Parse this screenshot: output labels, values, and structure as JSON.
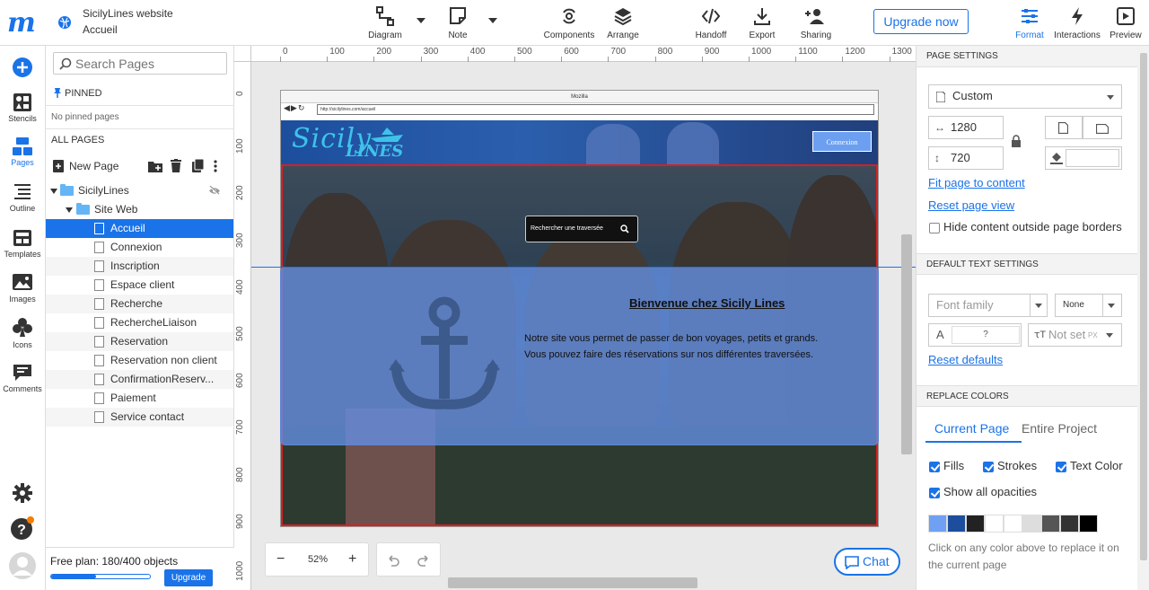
{
  "header": {
    "project_title": "SicilyLines website",
    "page_name": "Accueil",
    "tools": [
      {
        "label": "Diagram",
        "icon": "diagram-icon"
      },
      {
        "label": "Note",
        "icon": "note-icon"
      },
      {
        "label": "Components",
        "icon": "components-icon"
      },
      {
        "label": "Arrange",
        "icon": "arrange-icon"
      },
      {
        "label": "Handoff",
        "icon": "handoff-icon"
      },
      {
        "label": "Export",
        "icon": "export-icon"
      },
      {
        "label": "Sharing",
        "icon": "sharing-icon"
      },
      {
        "label": "Format",
        "icon": "format-icon"
      },
      {
        "label": "Interactions",
        "icon": "interactions-icon"
      },
      {
        "label": "Preview",
        "icon": "preview-icon"
      }
    ],
    "upgrade_label": "Upgrade now",
    "accent": "#1a73e8"
  },
  "rail": {
    "items": [
      {
        "label": "Stencils"
      },
      {
        "label": "Pages"
      },
      {
        "label": "Outline"
      },
      {
        "label": "Templates"
      },
      {
        "label": "Images"
      },
      {
        "label": "Icons"
      },
      {
        "label": "Comments"
      }
    ]
  },
  "pages_panel": {
    "search_placeholder": "Search Pages",
    "pinned_label": "PINNED",
    "no_pinned": "No pinned pages",
    "all_pages_label": "ALL PAGES",
    "new_page_label": "New Page",
    "tree": {
      "root": "SicilyLines",
      "folder": "Site Web",
      "pages": [
        "Accueil",
        "Connexion",
        "Inscription",
        "Espace client",
        "Recherche",
        "RechercheLiaison",
        "Reservation",
        "Reservation non client",
        "ConfirmationReserv...",
        "Paiement",
        "Service contact"
      ],
      "selected": "Accueil"
    },
    "plan_text": "Free plan: 180/400 objects",
    "plan_used": 180,
    "plan_total": 400,
    "plan_upgrade": "Upgrade"
  },
  "canvas": {
    "ruler_h": [
      "0",
      "100",
      "200",
      "300",
      "400",
      "500",
      "600",
      "700",
      "800",
      "900",
      "1000",
      "1100",
      "1200",
      "1300"
    ],
    "ruler_v": [
      "0",
      "100",
      "200",
      "300",
      "400",
      "500",
      "600",
      "700",
      "800",
      "900",
      "1000"
    ],
    "browser_title": "Mozilla",
    "browser_url": "http://sicilylines.com/accueil",
    "site_logo_top": "Sicily",
    "site_logo_bottom": "LINES",
    "connexion_label": "Connexion",
    "search_label": "Rechercher une traversée",
    "welcome_title": "Bienvenue chez Sicily Lines",
    "welcome_line1": "Notre site vous permet de passer de bon voyages, petits et grands.",
    "welcome_line2": "Vous pouvez faire des réservations sur nos différentes traversées.",
    "zoom": "52%",
    "chat_label": "Chat"
  },
  "right_panel": {
    "page_settings_label": "PAGE SETTINGS",
    "size_preset": "Custom",
    "width": "1280",
    "height": "720",
    "fit_link": "Fit page to content",
    "reset_view_link": "Reset page view",
    "hide_outside_label": "Hide content outside page borders",
    "default_text_label": "DEFAULT TEXT SETTINGS",
    "font_family_placeholder": "Font family",
    "font_weight": "None",
    "font_size": "?",
    "line_height": "Not set",
    "line_height_unit": "PX",
    "reset_defaults_link": "Reset defaults",
    "replace_colors_label": "REPLACE COLORS",
    "tab_current": "Current Page",
    "tab_project": "Entire Project",
    "fills_label": "Fills",
    "strokes_label": "Strokes",
    "text_color_label": "Text Color",
    "show_opacities_label": "Show all opacities",
    "swatches": [
      "#6fa0f3",
      "#1d4e9e",
      "#222222",
      "#ffffff",
      "#ffffff",
      "#dddddd",
      "#555555",
      "#333333",
      "#000000"
    ],
    "replace_hint": "Click on any color above to replace it on the current page"
  }
}
